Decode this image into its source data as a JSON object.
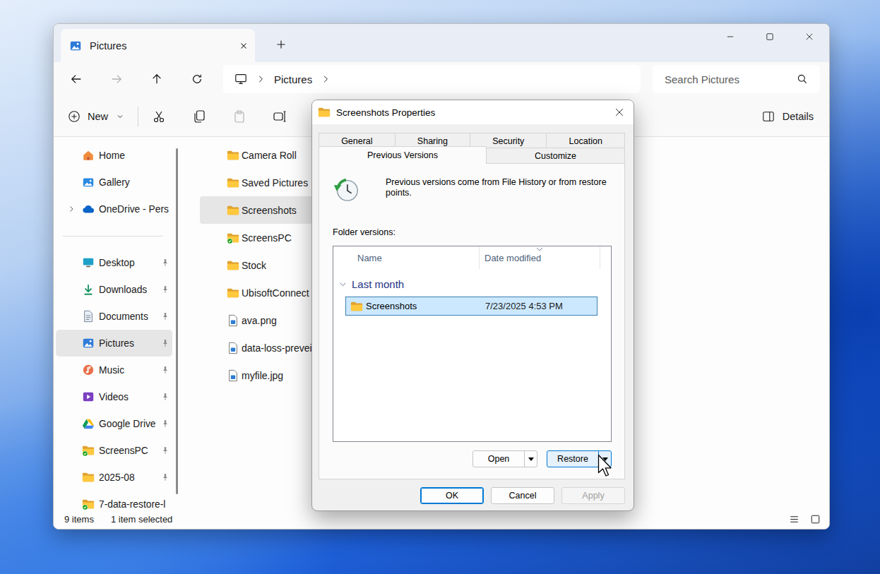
{
  "explorer": {
    "tab": {
      "title": "Pictures"
    },
    "navigation": [
      {
        "kind": "back",
        "disabled": false
      },
      {
        "kind": "forward",
        "disabled": true
      },
      {
        "kind": "up",
        "disabled": false
      },
      {
        "kind": "refresh",
        "disabled": false
      }
    ],
    "address": {
      "segments": [
        "Pictures"
      ]
    },
    "search": {
      "placeholder": "Search Pictures"
    },
    "toolbar": {
      "new_label": "New",
      "actions": [
        {
          "kind": "cut",
          "disabled": false
        },
        {
          "kind": "copy",
          "disabled": false
        },
        {
          "kind": "paste",
          "disabled": true
        },
        {
          "kind": "rename",
          "disabled": false
        }
      ],
      "details_label": "Details"
    },
    "sidebar": {
      "top": [
        {
          "label": "Home",
          "kind": "home",
          "selected": false,
          "expandable": false,
          "expanded": false
        },
        {
          "label": "Gallery",
          "kind": "gallery",
          "selected": false,
          "expandable": false,
          "expanded": false
        },
        {
          "label": "OneDrive - Pers",
          "kind": "cloud",
          "selected": false,
          "expandable": true,
          "expanded": false
        }
      ],
      "pinned": [
        {
          "label": "Desktop",
          "kind": "desktop",
          "selected": false,
          "pinned": true
        },
        {
          "label": "Downloads",
          "kind": "downloads",
          "selected": false,
          "pinned": true
        },
        {
          "label": "Documents",
          "kind": "documents",
          "selected": false,
          "pinned": true
        },
        {
          "label": "Pictures",
          "kind": "pictures",
          "selected": true,
          "pinned": true
        },
        {
          "label": "Music",
          "kind": "music",
          "selected": false,
          "pinned": true
        },
        {
          "label": "Videos",
          "kind": "videos",
          "selected": false,
          "pinned": true
        },
        {
          "label": "Google Drive",
          "kind": "google-drive",
          "selected": false,
          "pinned": true
        },
        {
          "label": "ScreensPC",
          "kind": "synced-folder",
          "selected": false,
          "pinned": true
        },
        {
          "label": "2025-08",
          "kind": "folder",
          "selected": false,
          "pinned": true
        },
        {
          "label": "7-data-restore-l",
          "kind": "synced-folder",
          "selected": false,
          "pinned": false
        }
      ]
    },
    "files": [
      {
        "name": "Camera Roll",
        "kind": "folder",
        "selected": false
      },
      {
        "name": "Saved Pictures",
        "kind": "folder",
        "selected": false
      },
      {
        "name": "Screenshots",
        "kind": "folder",
        "selected": true
      },
      {
        "name": "ScreensPC",
        "kind": "synced-folder",
        "selected": false
      },
      {
        "name": "Stock",
        "kind": "folder",
        "selected": false
      },
      {
        "name": "UbisoftConnect",
        "kind": "folder",
        "selected": false
      },
      {
        "name": "ava.png",
        "kind": "image",
        "selected": false
      },
      {
        "name": "data-loss-prevei",
        "kind": "image",
        "selected": false
      },
      {
        "name": "myfile.jpg",
        "kind": "image",
        "selected": false
      }
    ],
    "status_bar": {
      "count": "9 items",
      "selection": "1 item selected"
    }
  },
  "dialog": {
    "title": "Screenshots Properties",
    "tab_rows": [
      [
        {
          "label": "General",
          "selected": false
        },
        {
          "label": "Sharing",
          "selected": false
        },
        {
          "label": "Security",
          "selected": false
        },
        {
          "label": "Location",
          "selected": false
        }
      ],
      [
        {
          "label": "Previous Versions",
          "selected": true
        },
        {
          "label": "Customize",
          "selected": false
        }
      ]
    ],
    "info": "Previous versions come from File History or from restore points.",
    "list_label": "Folder versions:",
    "columns": [
      {
        "label": "Name",
        "sorted": false
      },
      {
        "label": "Date modified",
        "sorted": true
      }
    ],
    "groups": [
      {
        "label": "Last month",
        "expanded": true,
        "rows": [
          {
            "name": "Screenshots",
            "date": "7/23/2025 4:53 PM",
            "selected": true
          }
        ]
      }
    ],
    "actions": [
      {
        "label": "Open",
        "hovered": false
      },
      {
        "label": "Restore",
        "hovered": true
      }
    ],
    "footer": [
      {
        "label": "OK",
        "default": true,
        "disabled": false
      },
      {
        "label": "Cancel",
        "default": false,
        "disabled": false
      },
      {
        "label": "Apply",
        "default": false,
        "disabled": true
      }
    ]
  }
}
